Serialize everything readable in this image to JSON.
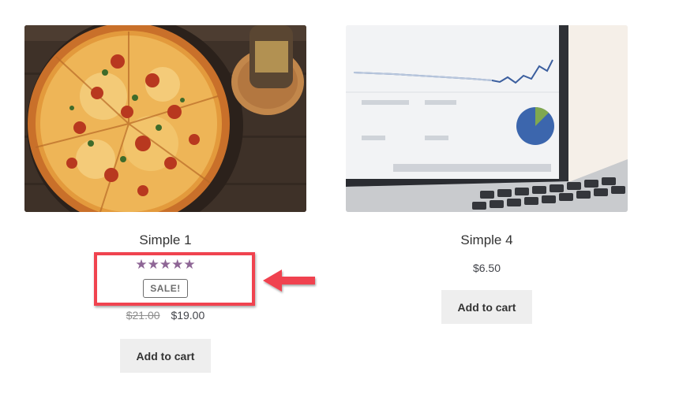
{
  "products": [
    {
      "title": "Simple 1",
      "rating_stars": "★★★★★",
      "sale_badge": "SALE!",
      "old_price": "$21.00",
      "price": "$19.00",
      "add_to_cart": "Add to cart"
    },
    {
      "title": "Simple 4",
      "price": "$6.50",
      "add_to_cart": "Add to cart"
    }
  ],
  "colors": {
    "star": "#8e6696",
    "highlight": "#f0434f",
    "button_bg": "#eeeeee"
  }
}
